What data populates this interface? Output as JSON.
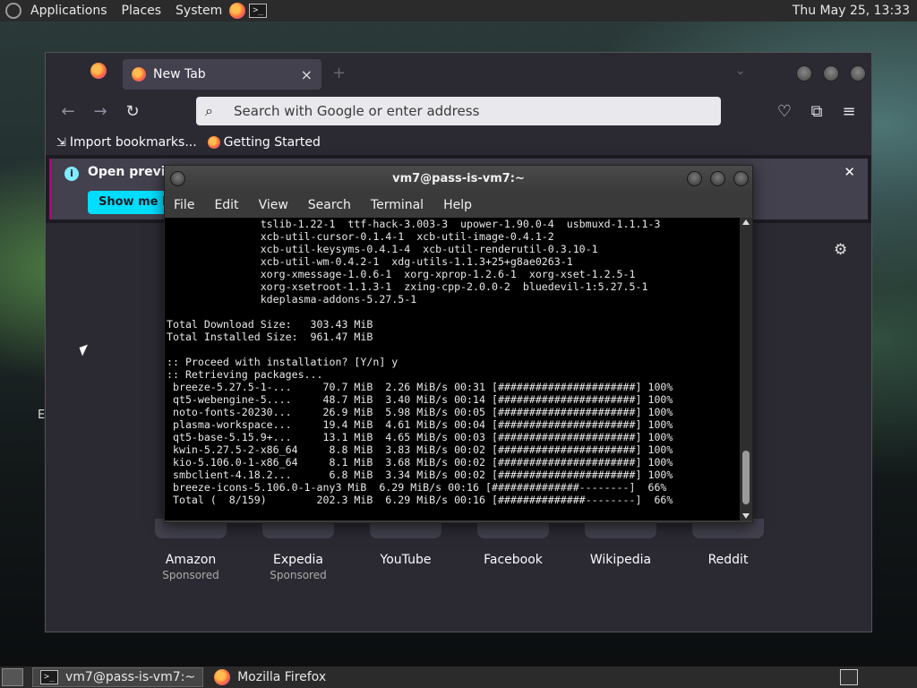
{
  "top_panel": {
    "applications": "Applications",
    "places": "Places",
    "system": "System",
    "clock": "Thu May 25, 13:33"
  },
  "firefox": {
    "tab_title": "New Tab",
    "tab_close": "×",
    "new_tab": "+",
    "tablist": "⌄",
    "search_placeholder": "Search with Google or enter address",
    "bookmarks": [
      {
        "label": "Import bookmarks...",
        "icon": "import-icon"
      },
      {
        "label": "Getting Started",
        "icon": "firefox-icon"
      }
    ],
    "infobar": {
      "message": "Open previo",
      "button": "Show me ho",
      "close": "✕"
    },
    "sites": [
      {
        "name": "Amazon",
        "sponsored": "Sponsored"
      },
      {
        "name": "Expedia",
        "sponsored": "Sponsored"
      },
      {
        "name": "YouTube",
        "sponsored": ""
      },
      {
        "name": "Facebook",
        "sponsored": ""
      },
      {
        "name": "Wikipedia",
        "sponsored": ""
      },
      {
        "name": "Reddit",
        "sponsored": ""
      }
    ]
  },
  "terminal": {
    "title": "vm7@pass-is-vm7:~",
    "menu": [
      "File",
      "Edit",
      "View",
      "Search",
      "Terminal",
      "Help"
    ],
    "output": "               tslib-1.22-1  ttf-hack-3.003-3  upower-1.90.0-4  usbmuxd-1.1.1-3\n               xcb-util-cursor-0.1.4-1  xcb-util-image-0.4.1-2\n               xcb-util-keysyms-0.4.1-4  xcb-util-renderutil-0.3.10-1\n               xcb-util-wm-0.4.2-1  xdg-utils-1.1.3+25+g8ae0263-1\n               xorg-xmessage-1.0.6-1  xorg-xprop-1.2.6-1  xorg-xset-1.2.5-1\n               xorg-xsetroot-1.1.3-1  zxing-cpp-2.0.0-2  bluedevil-1:5.27.5-1\n               kdeplasma-addons-5.27.5-1\n\nTotal Download Size:   303.43 MiB\nTotal Installed Size:  961.47 MiB\n\n:: Proceed with installation? [Y/n] y\n:: Retrieving packages...\n breeze-5.27.5-1-...     70.7 MiB  2.26 MiB/s 00:31 [######################] 100%\n qt5-webengine-5....     48.7 MiB  3.40 MiB/s 00:14 [######################] 100%\n noto-fonts-20230...     26.9 MiB  5.98 MiB/s 00:05 [######################] 100%\n plasma-workspace...     19.4 MiB  4.61 MiB/s 00:04 [######################] 100%\n qt5-base-5.15.9+...     13.1 MiB  4.65 MiB/s 00:03 [######################] 100%\n kwin-5.27.5-2-x86_64     8.8 MiB  3.83 MiB/s 00:02 [######################] 100%\n kio-5.106.0-1-x86_64     8.1 MiB  3.68 MiB/s 00:02 [######################] 100%\n smbclient-4.18.2...      6.8 MiB  3.34 MiB/s 00:02 [######################] 100%\n breeze-icons-5.106.0-1-any3 MiB  6.29 MiB/s 00:16 [##############--------]  66%\n Total (  8/159)        202.3 MiB  6.29 MiB/s 00:16 [##############--------]  66%"
  },
  "taskbar": {
    "tasks": [
      {
        "label": "vm7@pass-is-vm7:~",
        "icon": "terminal-icon",
        "active": true
      },
      {
        "label": "Mozilla Firefox",
        "icon": "firefox-icon",
        "active": false
      }
    ]
  },
  "desktop": {
    "partial_label": "E"
  }
}
